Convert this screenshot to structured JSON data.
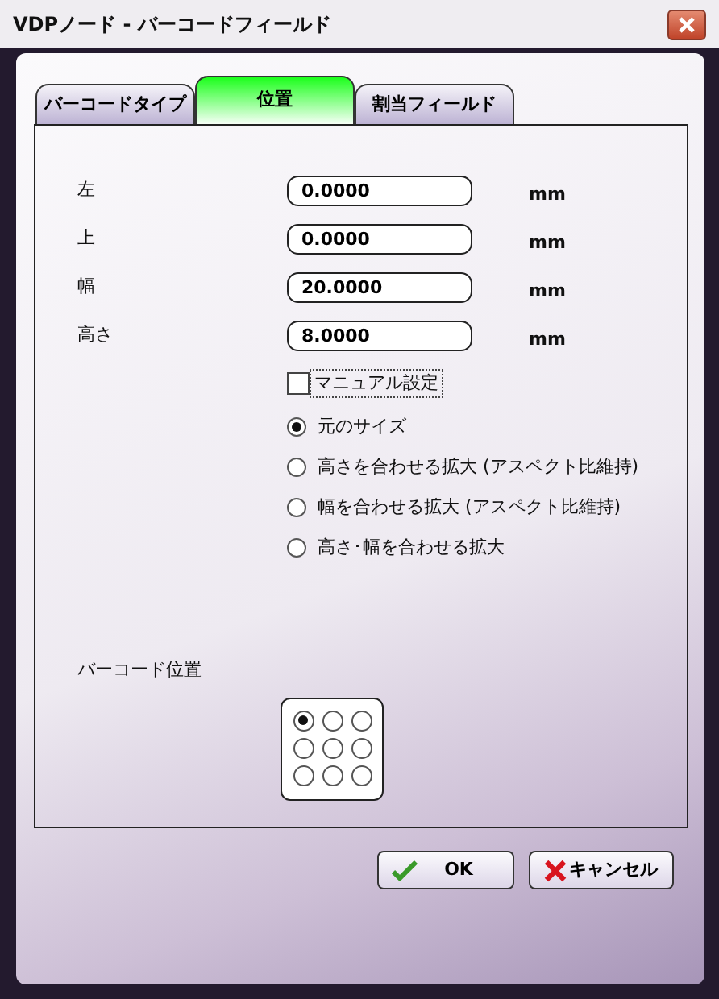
{
  "window": {
    "title": "VDPノード - バーコードフィールド"
  },
  "tabs": [
    {
      "label": "バーコードタイプ",
      "selected": false
    },
    {
      "label": "位置",
      "selected": true
    },
    {
      "label": "割当フィールド",
      "selected": false
    }
  ],
  "fields": [
    {
      "label": "左",
      "value": "0.0000",
      "unit": "mm"
    },
    {
      "label": "上",
      "value": "0.0000",
      "unit": "mm"
    },
    {
      "label": "幅",
      "value": "20.0000",
      "unit": "mm"
    },
    {
      "label": "高さ",
      "value": "8.0000",
      "unit": "mm"
    }
  ],
  "manual_setting": {
    "label": "マニュアル設定",
    "checked": false
  },
  "size_options": [
    {
      "label": "元のサイズ",
      "selected": true
    },
    {
      "label": "高さを合わせる拡大 (アスペクト比維持)",
      "selected": false
    },
    {
      "label": "幅を合わせる拡大 (アスペクト比維持)",
      "selected": false
    },
    {
      "label": "高さ･幅を合わせる拡大",
      "selected": false
    }
  ],
  "barcode_position": {
    "label": "バーコード位置",
    "cells": [
      {
        "selected": true
      },
      {
        "selected": false
      },
      {
        "selected": false
      },
      {
        "selected": false
      },
      {
        "selected": false
      },
      {
        "selected": false
      },
      {
        "selected": false
      },
      {
        "selected": false
      },
      {
        "selected": false
      }
    ]
  },
  "buttons": [
    {
      "label": "OK",
      "kind": "ok"
    },
    {
      "label": "キャンセル",
      "kind": "cancel"
    }
  ]
}
